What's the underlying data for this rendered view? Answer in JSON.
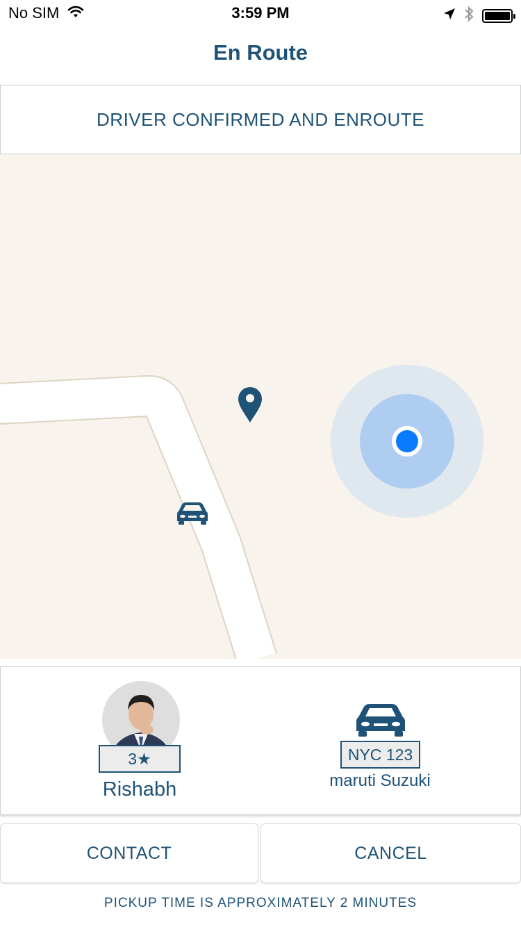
{
  "status_bar": {
    "carrier": "No SIM",
    "time": "3:59 PM",
    "icons": [
      "wifi-icon",
      "location-arrow-icon",
      "bluetooth-icon",
      "battery-icon"
    ]
  },
  "nav": {
    "title": "En Route"
  },
  "ride_status": {
    "text": "DRIVER CONFIRMED AND ENROUTE"
  },
  "map": {
    "icons": [
      "destination-pin-icon",
      "driver-car-icon",
      "user-location-icon"
    ],
    "colors": {
      "background": "#f8f3ec",
      "road": "#ffffff",
      "road_edge": "#ddd4c4",
      "user_dot": "#0a7bff",
      "accent": "#1e5276"
    }
  },
  "driver": {
    "rating": "3★",
    "name": "Rishabh"
  },
  "vehicle": {
    "plate": "NYC 123",
    "model": "maruti Suzuki"
  },
  "actions": {
    "contact_label": "CONTACT",
    "cancel_label": "CANCEL"
  },
  "pickup": {
    "text": "PICKUP TIME IS APPROXIMATELY 2 MINUTES"
  }
}
